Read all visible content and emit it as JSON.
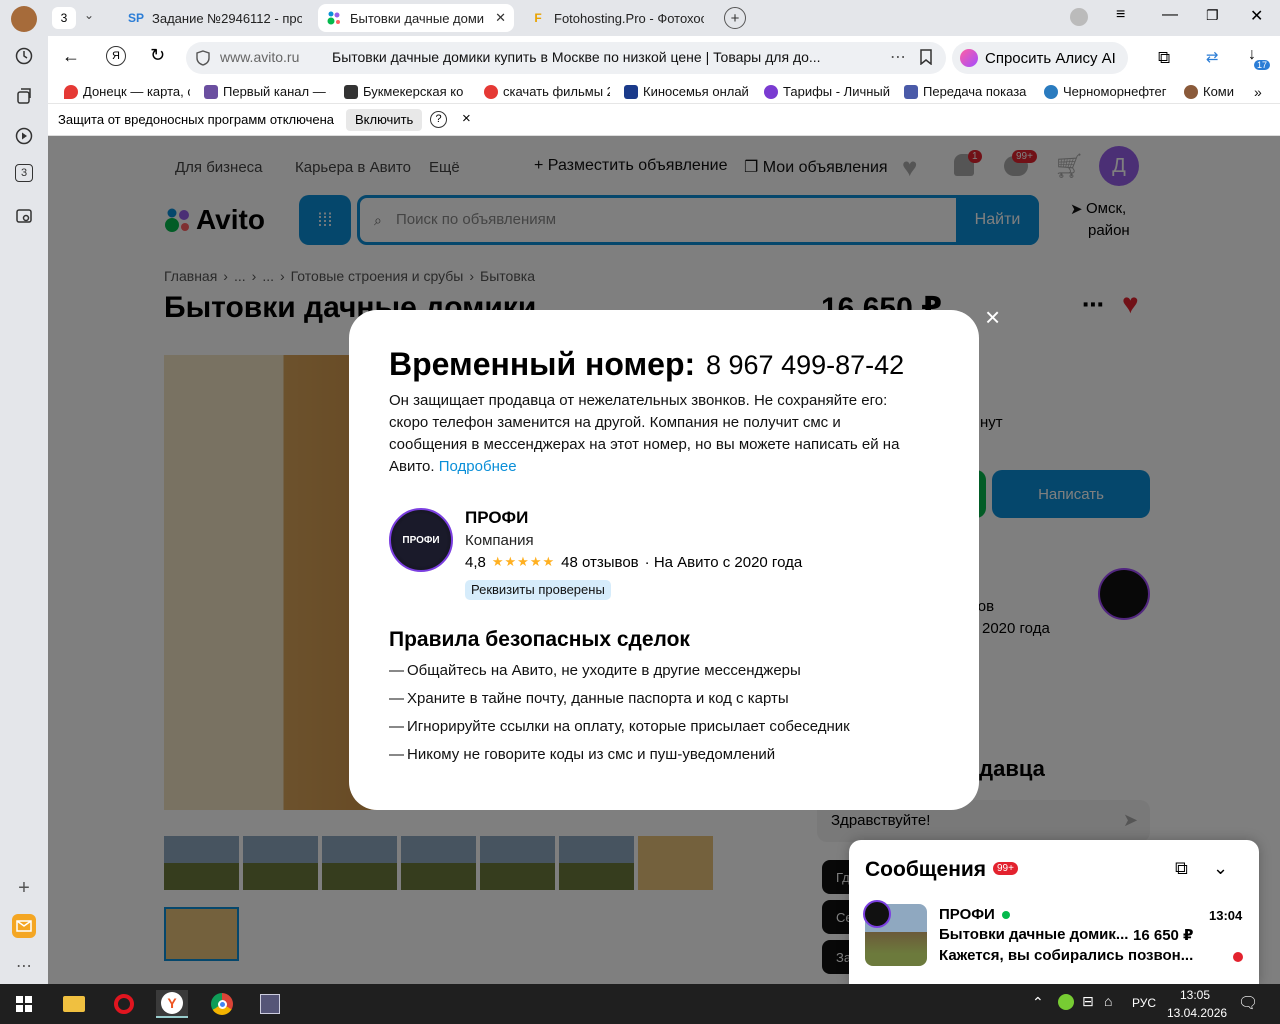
{
  "browser": {
    "tab_count": "3",
    "tabs": [
      {
        "icon": "SP",
        "title": "Задание №2946112 - про"
      },
      {
        "icon": "avito-icon",
        "title": "Бытовки дачные доми"
      },
      {
        "icon": "F",
        "title": "Fotohosting.Pro - Фотохос"
      }
    ],
    "address": {
      "domain": "www.avito.ru",
      "page_title": "Бытовки дачные домики купить в Москве по низкой цене | Товары для до..."
    },
    "alice_label": "Спросить Алису AI",
    "downloads_badge": "17",
    "bookmarks": [
      "Донецк — карта, с",
      "Первый канал — с",
      "Букмекерская ко",
      "скачать фильмы 2",
      "Киносемья онлай",
      "Тарифы - Личный",
      "Передача показа",
      "Черноморнефтег",
      "Коми"
    ],
    "leftbar_badge": "3",
    "infobar": {
      "text": "Защита от вредоносных программ отключена",
      "button": "Включить",
      "help": "?",
      "close": "×"
    }
  },
  "avito": {
    "top_nav": [
      "Для бизнеса",
      "Карьера в Авито",
      "Ещё"
    ],
    "place_ad": "Разместить объявление",
    "my_ads": "Мои объявления",
    "bell_badge": "1",
    "msg_badge": "99+",
    "avatar_letter": "Д",
    "logo": "Avito",
    "search_placeholder": "Поиск по объявлениям",
    "search_button": "Найти",
    "location": [
      "Омск,",
      "район"
    ],
    "breadcrumbs": [
      "Главная",
      "...",
      "...",
      "Готовые строения и срубы",
      "Бытовка"
    ],
    "title": "Бытовки дачные домики",
    "price": "16 650 ₽",
    "side_text_1": "нут",
    "write_button": "Написать",
    "side_reviews": "вов",
    "side_year": "2020 года",
    "seller_heading": "одавца",
    "chat_input": "Здравствуйте!",
    "chips": [
      "Гд",
      "Се",
      "За"
    ]
  },
  "modal": {
    "heading": "Временный номер:",
    "phone": "8 967 499-87-42",
    "description": "Он защищает продавца от нежелательных звонков. Не сохраняйте его: скоро телефон заменится на другой. Компания не получит смс и сообщения в мессенджерах на этот номер, но вы можете написать ей на Авито.",
    "more_link": "Подробнее",
    "seller": {
      "name": "ПРОФИ",
      "type": "Компания",
      "rating": "4,8",
      "stars": "★★★★★",
      "reviews": "48 отзывов",
      "since": "· На Авито с 2020 года",
      "verified": "Реквизиты проверены",
      "logo_text": "ПРОФИ"
    },
    "rules_title": "Правила безопасных сделок",
    "rules": [
      "Общайтесь на Авито, не уходите в другие мессенджеры",
      "Храните в тайне почту, данные паспорта и код с карты",
      "Игнорируйте ссылки на оплату, которые присылает собеседник",
      "Никому не говорите коды из смс и пуш-уведомлений"
    ],
    "close": "×"
  },
  "messages": {
    "title": "Сообщения",
    "badge": "99+",
    "seller": "ПРОФИ",
    "time": "13:04",
    "item": "Бытовки дачные домик...",
    "price": "16 650 ₽",
    "preview": "Кажется, вы собирались позвон..."
  },
  "taskbar": {
    "lang": "РУС",
    "time": "13:05",
    "date": "13.04.2026"
  },
  "colors": {
    "avito_blue": "#0a8fd8",
    "avito_green": "#04b94c",
    "link": "#0a8fd8",
    "heart": "#e3222e"
  }
}
